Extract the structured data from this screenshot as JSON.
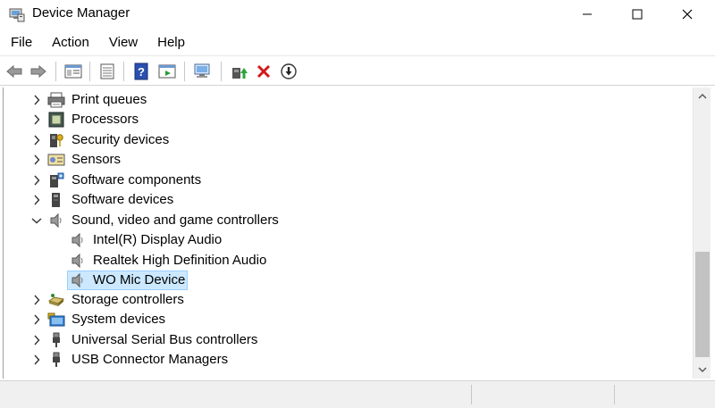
{
  "window": {
    "title": "Device Manager",
    "controls": [
      "minimize",
      "maximize",
      "close"
    ]
  },
  "menu": {
    "items": [
      {
        "label": "File"
      },
      {
        "label": "Action"
      },
      {
        "label": "View"
      },
      {
        "label": "Help"
      }
    ]
  },
  "toolbar": {
    "buttons": [
      "back-icon",
      "forward-icon",
      "properties-pane-icon",
      "list-view-icon",
      "help-icon",
      "run-icon",
      "scan-hardware-icon",
      "update-driver-icon",
      "uninstall-device-icon",
      "disable-device-icon"
    ]
  },
  "tree": {
    "nodes": [
      {
        "label": "Print queues",
        "level": 0,
        "expanded": false,
        "icon": "printer-icon"
      },
      {
        "label": "Processors",
        "level": 0,
        "expanded": false,
        "icon": "processor-icon"
      },
      {
        "label": "Security devices",
        "level": 0,
        "expanded": false,
        "icon": "security-key-icon"
      },
      {
        "label": "Sensors",
        "level": 0,
        "expanded": false,
        "icon": "sensor-icon"
      },
      {
        "label": "Software components",
        "level": 0,
        "expanded": false,
        "icon": "software-component-icon"
      },
      {
        "label": "Software devices",
        "level": 0,
        "expanded": false,
        "icon": "software-device-icon"
      },
      {
        "label": "Sound, video and game controllers",
        "level": 0,
        "expanded": true,
        "icon": "speaker-icon"
      },
      {
        "label": "Intel(R) Display Audio",
        "level": 1,
        "icon": "speaker-icon"
      },
      {
        "label": "Realtek High Definition Audio",
        "level": 1,
        "icon": "speaker-icon"
      },
      {
        "label": "WO Mic Device",
        "level": 1,
        "icon": "speaker-icon",
        "selected": true
      },
      {
        "label": "Storage controllers",
        "level": 0,
        "expanded": false,
        "icon": "storage-controller-icon"
      },
      {
        "label": "System devices",
        "level": 0,
        "expanded": false,
        "icon": "system-device-icon"
      },
      {
        "label": "Universal Serial Bus controllers",
        "level": 0,
        "expanded": false,
        "icon": "usb-icon"
      },
      {
        "label": "USB Connector Managers",
        "level": 0,
        "expanded": false,
        "icon": "usb-icon"
      }
    ]
  },
  "colors": {
    "selection_bg": "#cce8ff",
    "selection_border": "#99d1ff",
    "scroll_thumb": "#c2c2c2",
    "statusbar_bg": "#f0f0f0"
  }
}
